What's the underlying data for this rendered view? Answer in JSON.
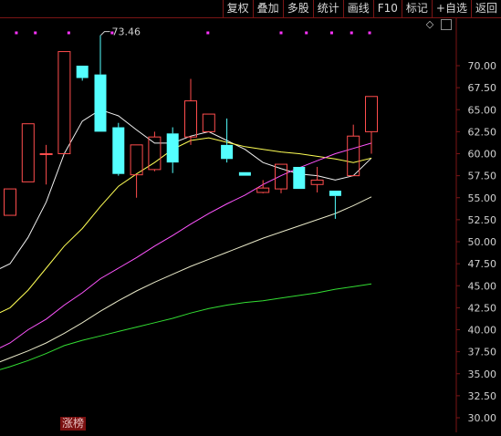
{
  "toolbar": {
    "buttons": [
      "复权",
      "叠加",
      "多股",
      "统计",
      "画线",
      "F10",
      "标记",
      "+自选",
      "返回"
    ]
  },
  "bottom_tag": "涨榜",
  "colors": {
    "background": "#000000",
    "grid": "#7a1515",
    "up_candle": "#ff4d4d",
    "down_candle": "#54ffff",
    "ma5": "#f0f0f0",
    "ma10": "#ffff55",
    "ma20": "#ff55ff",
    "ma60": "#e8e8c8",
    "ma120": "#33dd33",
    "axis_text": "#d0d0d0",
    "dot": "#ff33ff"
  },
  "icons": [
    "diamond-icon",
    "scroll-box-icon"
  ],
  "chart_data": {
    "type": "candlestick",
    "ylim": [
      29.5,
      75.5
    ],
    "y_ticks": [
      "70.00",
      "67.50",
      "65.00",
      "62.50",
      "60.00",
      "57.50",
      "55.00",
      "52.50",
      "50.00",
      "47.50",
      "45.00",
      "42.50",
      "40.00",
      "37.50",
      "35.00",
      "32.50",
      "30.00"
    ],
    "annotations": [
      {
        "text": "73.46",
        "x_index": 6,
        "y": 73.46
      }
    ],
    "candles": [
      {
        "o": 53.0,
        "c": 56.0,
        "h": 56.0,
        "l": 53.0
      },
      {
        "o": 56.8,
        "c": 63.4,
        "h": 63.4,
        "l": 56.8
      },
      {
        "o": 60.0,
        "c": 60.0,
        "h": 61.0,
        "l": 56.5
      },
      {
        "o": 60.0,
        "c": 71.6,
        "h": 71.6,
        "l": 60.0
      },
      {
        "o": 70.0,
        "c": 68.6,
        "h": 70.0,
        "l": 68.3
      },
      {
        "o": 69.0,
        "c": 62.5,
        "h": 73.46,
        "l": 62.5
      },
      {
        "o": 63.0,
        "c": 57.7,
        "h": 63.5,
        "l": 57.5
      },
      {
        "o": 57.6,
        "c": 61.0,
        "h": 61.0,
        "l": 55.0
      },
      {
        "o": 58.2,
        "c": 61.9,
        "h": 62.5,
        "l": 58.0
      },
      {
        "o": 62.3,
        "c": 59.0,
        "h": 63.0,
        "l": 57.8
      },
      {
        "o": 61.9,
        "c": 66.0,
        "h": 68.5,
        "l": 61.0
      },
      {
        "o": 62.5,
        "c": 64.5,
        "h": 64.5,
        "l": 62.5
      },
      {
        "o": 61.0,
        "c": 59.4,
        "h": 64.0,
        "l": 59.0
      },
      {
        "o": 57.9,
        "c": 57.5,
        "h": 57.9,
        "l": 57.5
      },
      {
        "o": 55.6,
        "c": 56.1,
        "h": 57.0,
        "l": 55.5
      },
      {
        "o": 56.0,
        "c": 58.8,
        "h": 58.8,
        "l": 55.5
      },
      {
        "o": 58.5,
        "c": 56.0,
        "h": 58.5,
        "l": 56.0
      },
      {
        "o": 56.5,
        "c": 57.0,
        "h": 58.5,
        "l": 55.6
      },
      {
        "o": 55.8,
        "c": 55.2,
        "h": 55.8,
        "l": 52.6
      },
      {
        "o": 57.5,
        "c": 62.0,
        "h": 63.3,
        "l": 57.5
      },
      {
        "o": 62.5,
        "c": 66.5,
        "h": 66.5,
        "l": 60.0
      }
    ],
    "ma_lines": [
      {
        "name": "MA5",
        "color": "#f0f0f0",
        "points": [
          [
            -1,
            46.5
          ],
          [
            0,
            47.5
          ],
          [
            1,
            50.5
          ],
          [
            2,
            54.5
          ],
          [
            3,
            60.0
          ],
          [
            4,
            63.7
          ],
          [
            5,
            65.0
          ],
          [
            6,
            64.3
          ],
          [
            7,
            62.7
          ],
          [
            8,
            61.2
          ],
          [
            9,
            61.2
          ],
          [
            10,
            62.0
          ],
          [
            11,
            62.5
          ],
          [
            12,
            61.5
          ],
          [
            13,
            60.5
          ],
          [
            14,
            59.0
          ],
          [
            15,
            58.3
          ],
          [
            16,
            57.7
          ],
          [
            17,
            57.5
          ],
          [
            18,
            57.0
          ],
          [
            19,
            57.5
          ],
          [
            20,
            59.5
          ]
        ]
      },
      {
        "name": "MA10",
        "color": "#ffff55",
        "points": [
          [
            -1,
            41.5
          ],
          [
            0,
            42.5
          ],
          [
            1,
            44.5
          ],
          [
            2,
            47.0
          ],
          [
            3,
            49.5
          ],
          [
            4,
            51.5
          ],
          [
            5,
            54.0
          ],
          [
            6,
            56.3
          ],
          [
            7,
            57.7
          ],
          [
            8,
            59.0
          ],
          [
            9,
            60.5
          ],
          [
            10,
            61.5
          ],
          [
            11,
            61.8
          ],
          [
            12,
            61.3
          ],
          [
            13,
            60.8
          ],
          [
            14,
            60.5
          ],
          [
            15,
            60.2
          ],
          [
            16,
            60.0
          ],
          [
            17,
            59.7
          ],
          [
            18,
            59.4
          ],
          [
            19,
            59.0
          ],
          [
            20,
            59.5
          ]
        ]
      },
      {
        "name": "MA20",
        "color": "#ff55ff",
        "points": [
          [
            -1,
            37.5
          ],
          [
            0,
            38.5
          ],
          [
            1,
            40.0
          ],
          [
            2,
            41.2
          ],
          [
            3,
            42.8
          ],
          [
            4,
            44.2
          ],
          [
            5,
            45.8
          ],
          [
            6,
            47.0
          ],
          [
            7,
            48.2
          ],
          [
            8,
            49.5
          ],
          [
            9,
            50.7
          ],
          [
            10,
            52.0
          ],
          [
            11,
            53.2
          ],
          [
            12,
            54.3
          ],
          [
            13,
            55.3
          ],
          [
            14,
            56.5
          ],
          [
            15,
            57.5
          ],
          [
            16,
            58.4
          ],
          [
            17,
            59.2
          ],
          [
            18,
            60.0
          ],
          [
            19,
            60.6
          ],
          [
            20,
            61.2
          ]
        ]
      },
      {
        "name": "MA60",
        "color": "#e8e8c8",
        "points": [
          [
            -1,
            36.0
          ],
          [
            0,
            36.8
          ],
          [
            1,
            37.6
          ],
          [
            2,
            38.5
          ],
          [
            3,
            39.6
          ],
          [
            4,
            40.8
          ],
          [
            5,
            42.1
          ],
          [
            6,
            43.3
          ],
          [
            7,
            44.4
          ],
          [
            8,
            45.4
          ],
          [
            9,
            46.3
          ],
          [
            10,
            47.2
          ],
          [
            11,
            48.0
          ],
          [
            12,
            48.8
          ],
          [
            13,
            49.6
          ],
          [
            14,
            50.4
          ],
          [
            15,
            51.1
          ],
          [
            16,
            51.8
          ],
          [
            17,
            52.5
          ],
          [
            18,
            53.2
          ],
          [
            19,
            54.1
          ],
          [
            20,
            55.1
          ]
        ]
      },
      {
        "name": "MA120",
        "color": "#33dd33",
        "points": [
          [
            -1,
            35.2
          ],
          [
            0,
            35.8
          ],
          [
            1,
            36.5
          ],
          [
            2,
            37.3
          ],
          [
            3,
            38.2
          ],
          [
            4,
            38.8
          ],
          [
            5,
            39.3
          ],
          [
            6,
            39.8
          ],
          [
            7,
            40.3
          ],
          [
            8,
            40.8
          ],
          [
            9,
            41.3
          ],
          [
            10,
            41.9
          ],
          [
            11,
            42.4
          ],
          [
            12,
            42.8
          ],
          [
            13,
            43.1
          ],
          [
            14,
            43.3
          ],
          [
            15,
            43.6
          ],
          [
            16,
            43.9
          ],
          [
            17,
            44.2
          ],
          [
            18,
            44.6
          ],
          [
            19,
            44.9
          ],
          [
            20,
            45.2
          ]
        ]
      }
    ],
    "top_dots_x_index": [
      -0.8,
      0.35,
      1.4,
      3.25,
      5.65,
      10.95,
      15.0,
      16.4,
      17.8,
      18.9,
      19.9
    ]
  }
}
